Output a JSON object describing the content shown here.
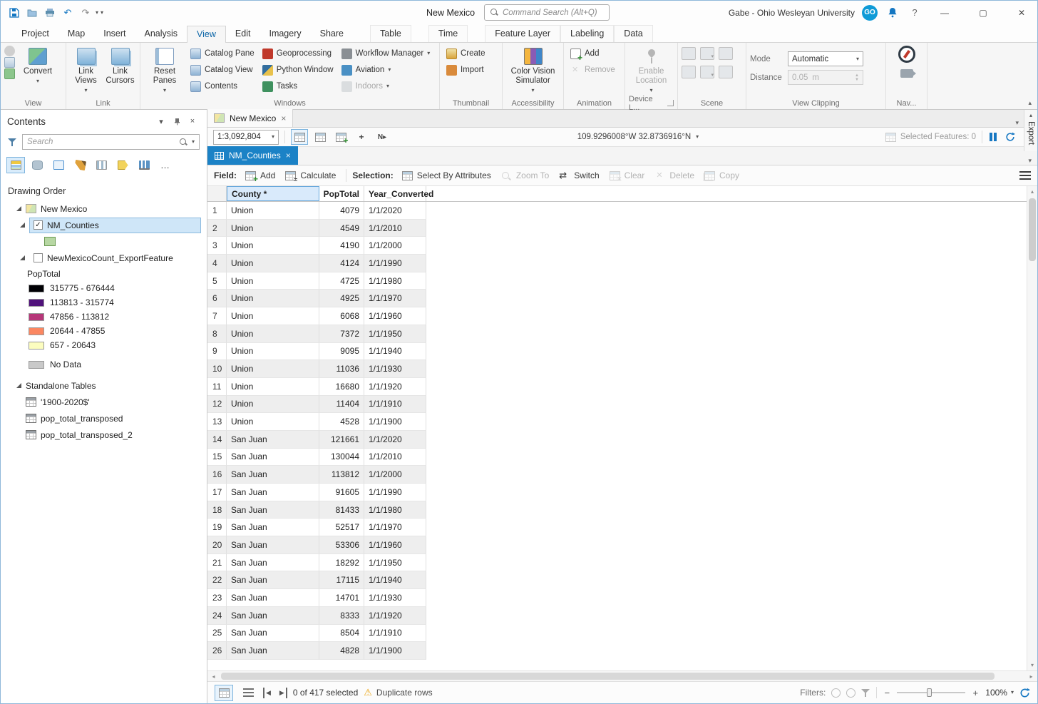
{
  "colors": {
    "accent_blue": "#1577c2",
    "table_tab_active_bg": "#1b82c6",
    "tree_selection_bg": "#cfe6f8",
    "row_alt_bg": "#eeeeee",
    "warning_yellow": "#eba616"
  },
  "titlebar": {
    "project_title": "New Mexico",
    "command_search_placeholder": "Command Search (Alt+Q)",
    "user_name": "Gabe - Ohio Wesleyan University",
    "avatar_initials": "GO",
    "help_label": "?"
  },
  "ribbon": {
    "tabs": [
      {
        "label": "Project"
      },
      {
        "label": "Map"
      },
      {
        "label": "Insert"
      },
      {
        "label": "Analysis"
      },
      {
        "label": "View",
        "active": true
      },
      {
        "label": "Edit"
      },
      {
        "label": "Imagery"
      },
      {
        "label": "Share"
      },
      {
        "label": "Table",
        "contextual": true,
        "gap": true
      },
      {
        "label": "Time",
        "contextual": true,
        "gap": true
      },
      {
        "label": "Feature Layer",
        "contextual": true,
        "gap": true
      },
      {
        "label": "Labeling",
        "contextual": true
      },
      {
        "label": "Data",
        "contextual": true
      }
    ],
    "groups": {
      "view": {
        "label": "View",
        "convert": "Convert"
      },
      "link": {
        "label": "Link",
        "link_views": "Link Views",
        "link_cursors": "Link Cursors"
      },
      "windows": {
        "label": "Windows",
        "reset_panes": "Reset Panes",
        "col1": [
          "Catalog Pane",
          "Catalog View",
          "Contents"
        ],
        "col2": [
          "Geoprocessing",
          "Python Window",
          "Tasks"
        ],
        "col3": [
          {
            "label": "Workflow Manager",
            "dropdown": true
          },
          {
            "label": "Aviation",
            "dropdown": true
          },
          {
            "label": "Indoors",
            "dropdown": true,
            "disabled": true
          }
        ]
      },
      "thumbnail": {
        "label": "Thumbnail",
        "create": "Create",
        "import": "Import"
      },
      "accessibility": {
        "label": "Accessibility",
        "button": "Color Vision Simulator"
      },
      "animation": {
        "label": "Animation",
        "add": "Add",
        "remove": "Remove"
      },
      "device": {
        "label": "Device L...",
        "button": "Enable Location"
      },
      "scene": {
        "label": "Scene"
      },
      "view_clipping": {
        "label": "View Clipping",
        "mode_label": "Mode",
        "mode_value": "Automatic",
        "distance_label": "Distance",
        "distance_value": "0.05",
        "distance_unit": "m"
      },
      "nav": {
        "label": "Nav..."
      }
    }
  },
  "contents_pane": {
    "title": "Contents",
    "search_placeholder": "Search",
    "drawing_order_label": "Drawing Order",
    "map_item": "New Mexico",
    "layers": [
      {
        "name": "NM_Counties",
        "checked": true,
        "selected": true,
        "swatch": "#b7d7a3"
      },
      {
        "name": "NewMexicoCount_ExportFeature",
        "checked": false
      }
    ],
    "legend": {
      "field": "PopTotal",
      "classes": [
        {
          "label": "315775 - 676444",
          "color": "#000004"
        },
        {
          "label": "113813 - 315774",
          "color": "#50127b"
        },
        {
          "label": "47856 - 113812",
          "color": "#b63679"
        },
        {
          "label": "20644 - 47855",
          "color": "#fb8761"
        },
        {
          "label": "657 - 20643",
          "color": "#fcfdbf"
        }
      ],
      "no_data": {
        "label": "No Data",
        "color": "#c9c9c9"
      }
    },
    "standalone_tables_label": "Standalone Tables",
    "standalone_tables": [
      "'1900-2020$'",
      "pop_total_transposed",
      "pop_total_transposed_2"
    ]
  },
  "view_tabs": {
    "map_tab_label": "New Mexico",
    "export_tab_label": "Export"
  },
  "map_toolbar": {
    "scale": "1:3,092,804",
    "coordinates": "109.9296008°W 32.8736916°N",
    "selected_features_label": "Selected Features: 0"
  },
  "table_view": {
    "tab": "NM_Counties",
    "toolbar": {
      "field_label": "Field:",
      "field_actions": [
        {
          "label": "Add"
        },
        {
          "label": "Calculate"
        }
      ],
      "selection_label": "Selection:",
      "selection_actions": [
        {
          "label": "Select By Attributes",
          "enabled": true
        },
        {
          "label": "Zoom To",
          "enabled": false
        },
        {
          "label": "Switch",
          "enabled": true
        },
        {
          "label": "Clear",
          "enabled": false
        },
        {
          "label": "Delete",
          "enabled": false
        },
        {
          "label": "Copy",
          "enabled": false
        }
      ]
    },
    "columns": [
      "County *",
      "PopTotal",
      "Year_Converted"
    ],
    "rows": [
      [
        "Union",
        "4079",
        "1/1/2020"
      ],
      [
        "Union",
        "4549",
        "1/1/2010"
      ],
      [
        "Union",
        "4190",
        "1/1/2000"
      ],
      [
        "Union",
        "4124",
        "1/1/1990"
      ],
      [
        "Union",
        "4725",
        "1/1/1980"
      ],
      [
        "Union",
        "4925",
        "1/1/1970"
      ],
      [
        "Union",
        "6068",
        "1/1/1960"
      ],
      [
        "Union",
        "7372",
        "1/1/1950"
      ],
      [
        "Union",
        "9095",
        "1/1/1940"
      ],
      [
        "Union",
        "11036",
        "1/1/1930"
      ],
      [
        "Union",
        "16680",
        "1/1/1920"
      ],
      [
        "Union",
        "11404",
        "1/1/1910"
      ],
      [
        "Union",
        "4528",
        "1/1/1900"
      ],
      [
        "San Juan",
        "121661",
        "1/1/2020"
      ],
      [
        "San Juan",
        "130044",
        "1/1/2010"
      ],
      [
        "San Juan",
        "113812",
        "1/1/2000"
      ],
      [
        "San Juan",
        "91605",
        "1/1/1990"
      ],
      [
        "San Juan",
        "81433",
        "1/1/1980"
      ],
      [
        "San Juan",
        "52517",
        "1/1/1970"
      ],
      [
        "San Juan",
        "53306",
        "1/1/1960"
      ],
      [
        "San Juan",
        "18292",
        "1/1/1950"
      ],
      [
        "San Juan",
        "17115",
        "1/1/1940"
      ],
      [
        "San Juan",
        "14701",
        "1/1/1930"
      ],
      [
        "San Juan",
        "8333",
        "1/1/1920"
      ],
      [
        "San Juan",
        "8504",
        "1/1/1910"
      ],
      [
        "San Juan",
        "4828",
        "1/1/1900"
      ]
    ]
  },
  "statusbar": {
    "selected_text": "0 of 417 selected",
    "warning_text": "Duplicate rows",
    "filters_label": "Filters:",
    "zoom_value": "100%"
  }
}
